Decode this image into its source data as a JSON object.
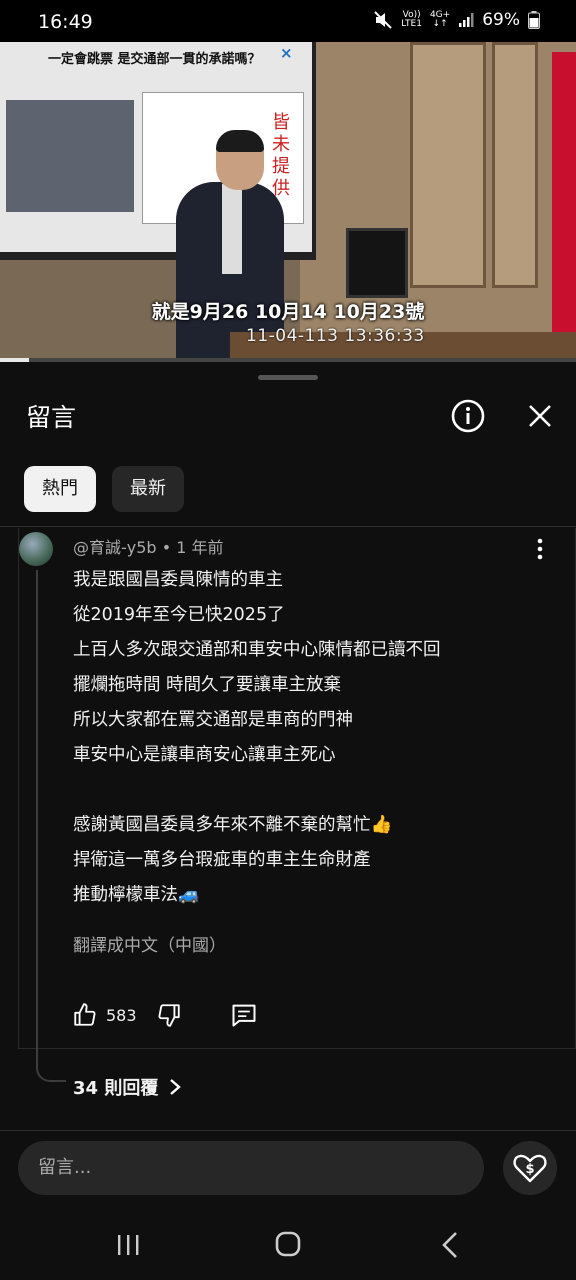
{
  "status_bar": {
    "time": "16:49",
    "volte_top": "Vo))",
    "volte_bottom": "LTE1",
    "network_top": "4G+",
    "network_bottom": "↓↑",
    "battery": "69%",
    "icons": [
      "mute-icon",
      "signal-icon",
      "battery-icon"
    ]
  },
  "video": {
    "slide_title": "一定會跳票 是交通部一貫的承諾嗎？",
    "slide_close": "×",
    "slide_side_text": "皆未提供",
    "subtitle": "就是9月26 10月14 10月23號",
    "timestamp": "11-04-113  13:36:33",
    "progress": 0.05
  },
  "sheet": {
    "title": "留言",
    "tabs": [
      {
        "label": "熱門",
        "active": true
      },
      {
        "label": "最新",
        "active": false
      }
    ]
  },
  "comment": {
    "author": "@育誠-y5b",
    "time": "1 年前",
    "lines": [
      "我是跟國昌委員陳情的車主",
      "從2019年至今已快2025了",
      "上百人多次跟交通部和車安中心陳情都已讀不回",
      "擺爛拖時間 時間久了要讓車主放棄",
      "所以大家都在罵交通部是車商的門神",
      "車安中心是讓車商安心讓車主死心",
      "",
      "感謝黃國昌委員多年來不離不棄的幫忙👍",
      "捍衛這一萬多台瑕疵車的車主生命財產",
      "推動檸檬車法🚙"
    ],
    "translate": "翻譯成中文（中國）",
    "likes": "583",
    "replies": "34 則回覆"
  },
  "input": {
    "placeholder": "留言..."
  },
  "colors": {
    "background": "#0f0f0f",
    "chip_active": "#f1f1f1",
    "chip_inactive": "#272727",
    "secondary_text": "#aaaaaa"
  }
}
